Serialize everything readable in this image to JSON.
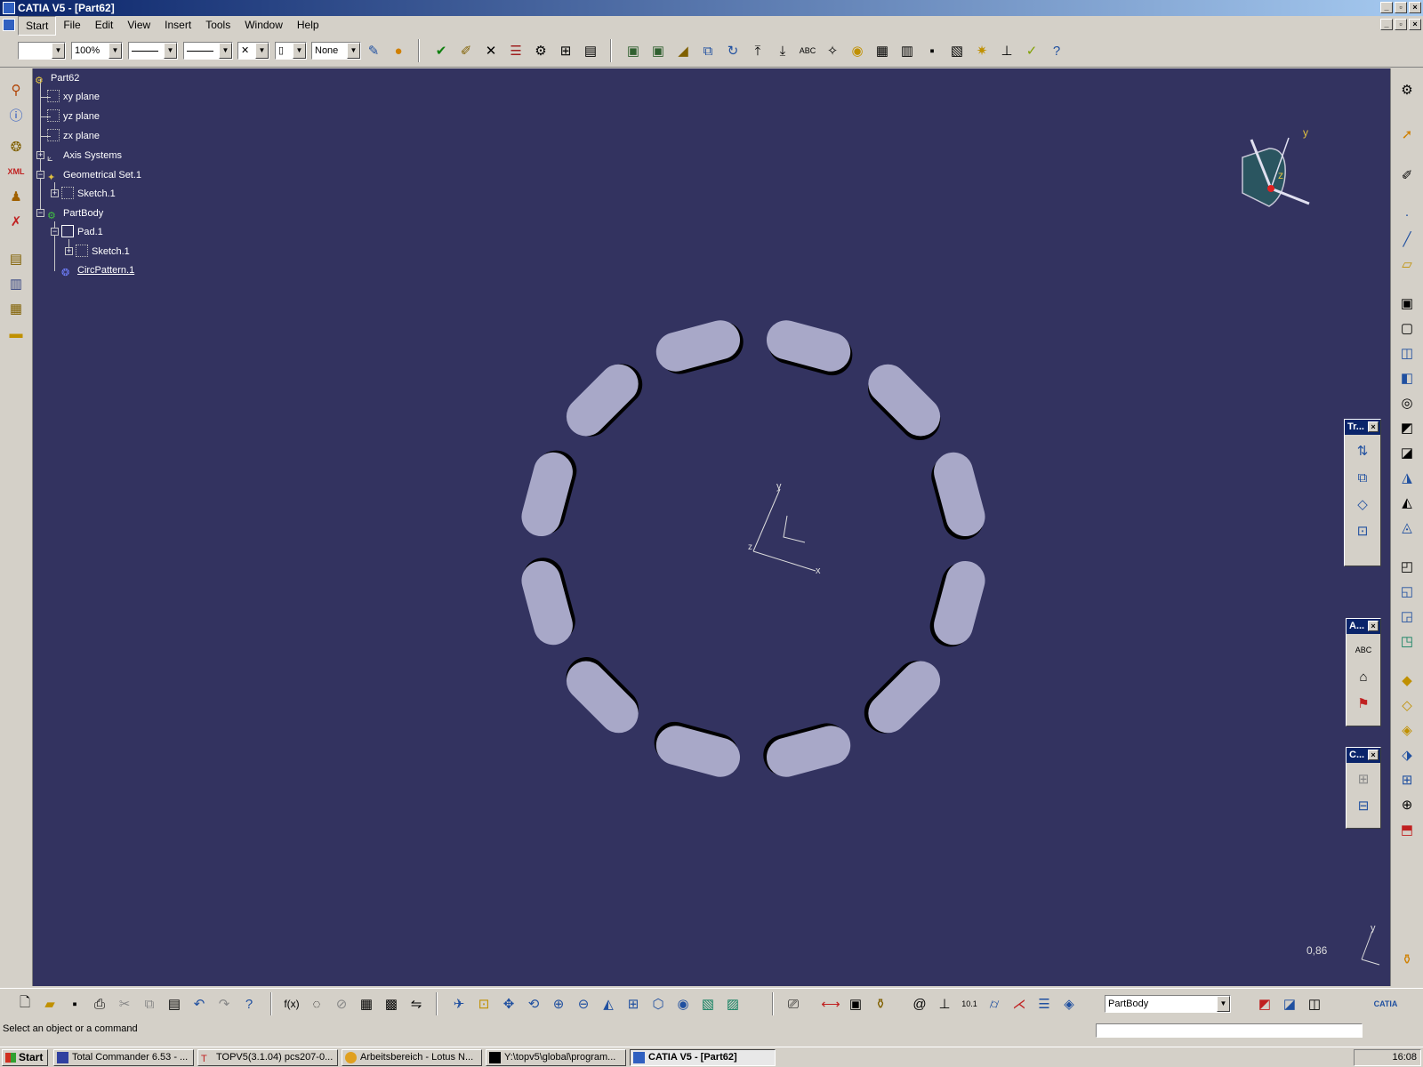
{
  "window": {
    "title": "CATIA V5 - [Part62]"
  },
  "menu": {
    "items": [
      "Start",
      "File",
      "Edit",
      "View",
      "Insert",
      "Tools",
      "Window",
      "Help"
    ]
  },
  "toolbar_top": {
    "zoom": "100%",
    "layer": "None"
  },
  "tree": {
    "root": "Part62",
    "xy_plane": "xy plane",
    "yz_plane": "yz plane",
    "zx_plane": "zx plane",
    "axis_systems": "Axis Systems",
    "geometrical_set": "Geometrical Set.1",
    "sketch_gs": "Sketch.1",
    "partbody": "PartBody",
    "pad": "Pad.1",
    "sketch_pad": "Sketch.1",
    "circ_pattern": "CircPattern.1"
  },
  "compass": {
    "x": "x",
    "y": "y",
    "z": "z"
  },
  "axes_center": {
    "x": "x",
    "y": "y",
    "z": "z"
  },
  "axes_corner": {
    "y": "y"
  },
  "zoom_readout": "0,86",
  "floating": {
    "transformations": "Tr...",
    "annotations": "A...",
    "constraints": "C..."
  },
  "bottom_toolbar": {
    "current_body": "PartBody"
  },
  "status": {
    "message": "Select an object or a command"
  },
  "taskbar": {
    "start": "Start",
    "tasks": [
      "Total Commander 6.53 - ...",
      "TOPV5(3.1.04) pcs207-0...",
      "Arbeitsbereich - Lotus N...",
      "Y:\\topv5\\global\\program...",
      "CATIA V5 - [Part62]"
    ],
    "clock": "16:08"
  },
  "colors": {
    "viewport": "#333360",
    "slot": "#a8a8c8",
    "titlebar": "#0a246a"
  }
}
